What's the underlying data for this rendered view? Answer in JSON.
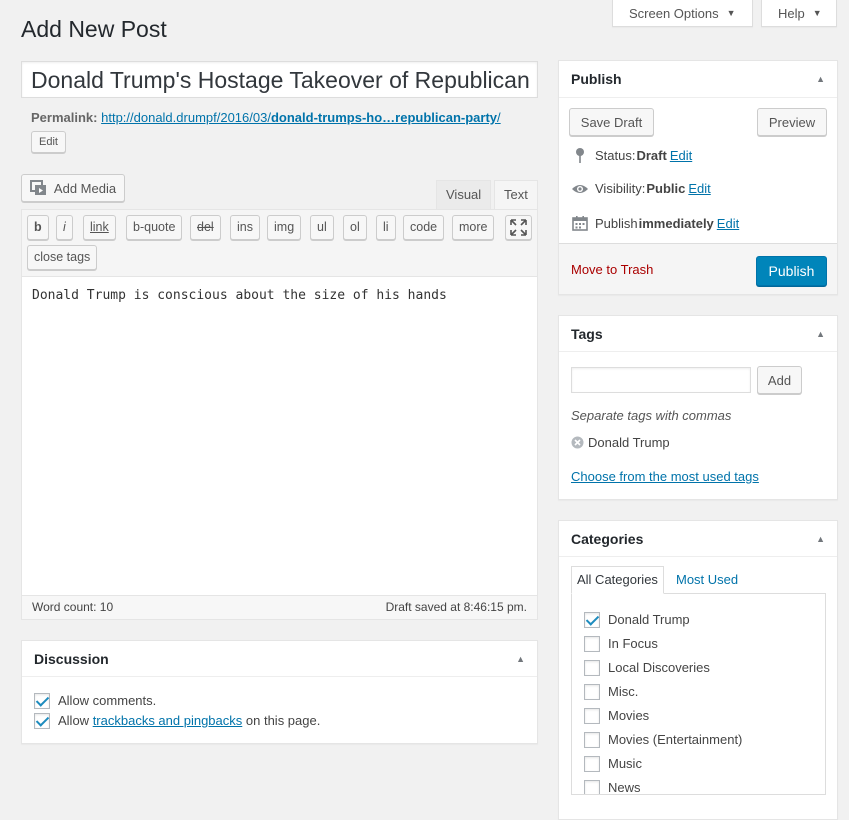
{
  "screen_options": {
    "label": "Screen Options"
  },
  "help": {
    "label": "Help"
  },
  "page_title": "Add New Post",
  "post_title": "Donald Trump's Hostage Takeover of Republican",
  "permalink": {
    "label": "Permalink:",
    "url_base": "http://donald.drumpf/2016/03/",
    "url_slug": "donald-trumps-ho…republican-party",
    "url_trailing": "/",
    "edit_label": "Edit"
  },
  "add_media": {
    "label": "Add Media"
  },
  "editor": {
    "tabs": [
      "Visual",
      "Text"
    ],
    "active_tab": "Text",
    "buttons": [
      "b",
      "i",
      "link",
      "b-quote",
      "del",
      "ins",
      "img",
      "ul",
      "ol",
      "li",
      "code",
      "more"
    ],
    "close_tags": "close tags",
    "content": "Donald Trump is conscious about the size of his hands",
    "word_count_label": "Word count: 10",
    "draft_saved": "Draft saved at 8:46:15 pm."
  },
  "discussion": {
    "title": "Discussion",
    "allow_comments": "Allow comments.",
    "allow_prefix": "Allow ",
    "trackbacks_link": "trackbacks and pingbacks",
    "allow_suffix": " on this page."
  },
  "publish": {
    "title": "Publish",
    "save_draft": "Save Draft",
    "preview": "Preview",
    "status_label": "Status: ",
    "status_value": "Draft",
    "visibility_label": "Visibility: ",
    "visibility_value": "Public",
    "publish_label": "Publish ",
    "publish_value": "immediately",
    "edit": "Edit",
    "move_to_trash": "Move to Trash",
    "publish_button": "Publish"
  },
  "tags": {
    "title": "Tags",
    "input_value": "",
    "add": "Add",
    "hint": "Separate tags with commas",
    "items": [
      "Donald Trump"
    ],
    "choose_link": "Choose from the most used tags"
  },
  "categories": {
    "title": "Categories",
    "tabs": [
      "All Categories",
      "Most Used"
    ],
    "items": [
      {
        "label": "Donald Trump",
        "checked": true
      },
      {
        "label": "In Focus",
        "checked": false
      },
      {
        "label": "Local Discoveries",
        "checked": false
      },
      {
        "label": "Misc.",
        "checked": false
      },
      {
        "label": "Movies",
        "checked": false
      },
      {
        "label": "Movies (Entertainment)",
        "checked": false
      },
      {
        "label": "Music",
        "checked": false
      },
      {
        "label": "News",
        "checked": false
      }
    ]
  },
  "colors": {
    "link": "#0073aa",
    "publish_button": "#0085ba",
    "trash": "#a00",
    "checkbox_check": "#1e8cbe"
  }
}
